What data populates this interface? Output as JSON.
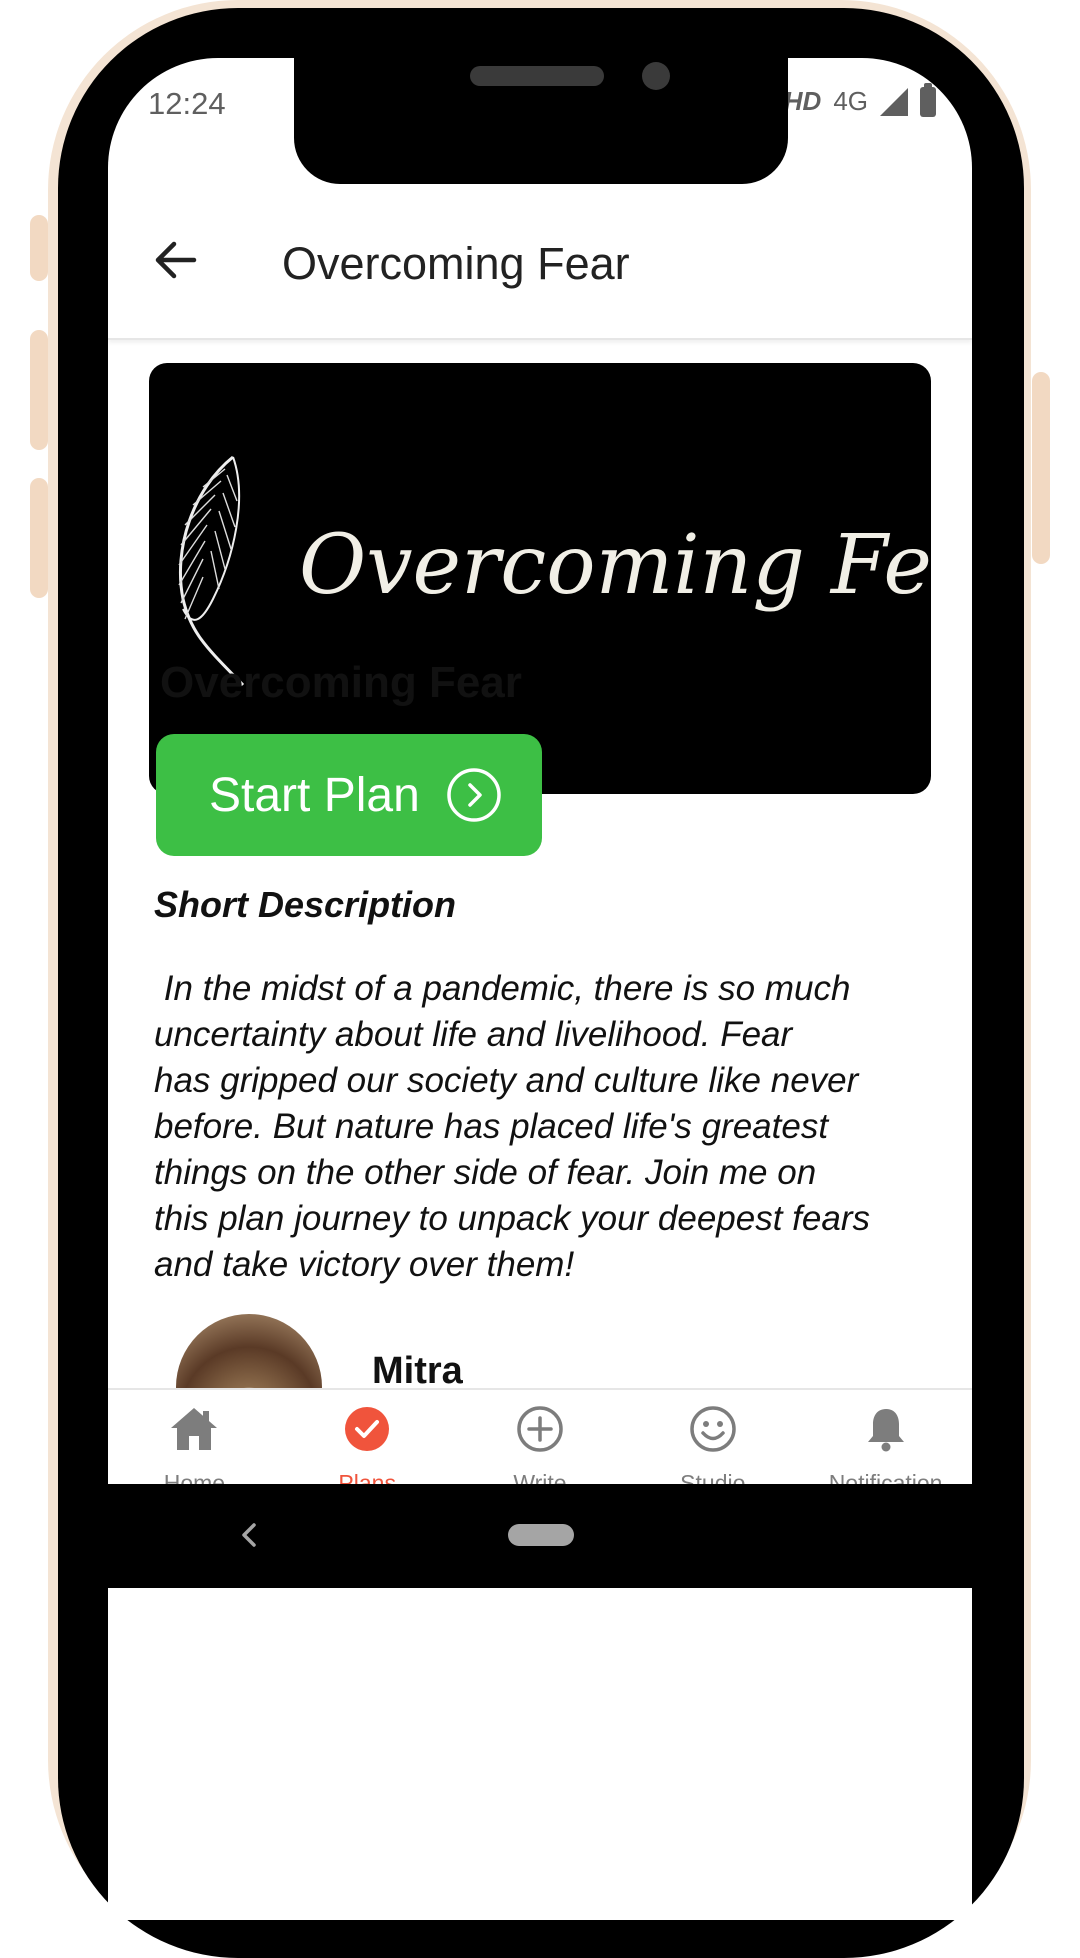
{
  "status_bar": {
    "time": "12:24",
    "network_quality": "HD",
    "network_type": "4G"
  },
  "appbar": {
    "title": "Overcoming Fear"
  },
  "banner": {
    "text": "Overcoming Fear"
  },
  "plan": {
    "title": "Overcoming Fear",
    "start_button": "Start Plan",
    "description_heading": "Short Description",
    "description": " In the midst of a pandemic, there is so much\nuncertainty about life and livelihood. Fear\nhas gripped our society and culture like never\nbefore. But nature has placed life's greatest\nthings on the other side of fear. Join me on\nthis plan journey to unpack your deepest fears\nand take victory over them!"
  },
  "author": {
    "name": "Mitra"
  },
  "bottom_nav": {
    "items": [
      {
        "label": "Home",
        "icon": "home-icon"
      },
      {
        "label": "Plans",
        "icon": "check-circle-icon",
        "active": true
      },
      {
        "label": "Write",
        "icon": "plus-circle-icon"
      },
      {
        "label": "Studio",
        "icon": "smiley-icon"
      },
      {
        "label": "Notification",
        "icon": "bell-icon"
      }
    ]
  },
  "colors": {
    "accent_green": "#3dbf45",
    "active_nav": "#f0543c",
    "inactive_nav": "#7d7d7d",
    "device_frame": "#f4e4d4"
  }
}
